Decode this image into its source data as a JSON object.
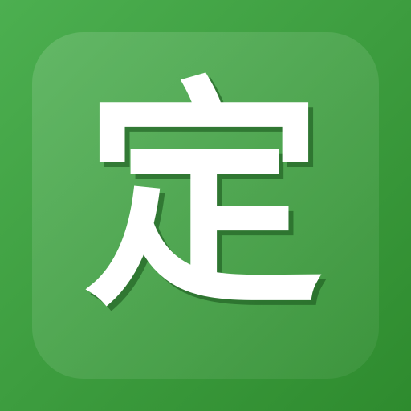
{
  "icon": {
    "glyph": "定",
    "colors": {
      "background_start": "#4CAF50",
      "background_end": "#2E8B2E",
      "panel_overlay": "rgba(255,255,255,0.12)",
      "glyph_fill": "#FFFFFF",
      "glyph_shadow": "#1F5E22"
    }
  }
}
